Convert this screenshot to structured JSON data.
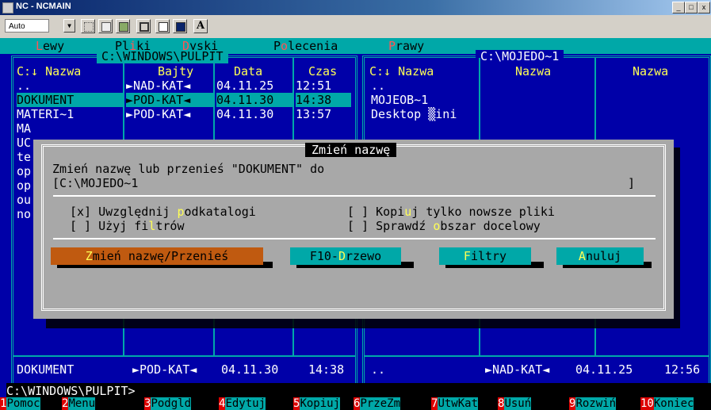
{
  "window": {
    "title": "NC - NCMAIN",
    "font_size_select": "Auto",
    "controls": [
      "_",
      "□",
      "x"
    ]
  },
  "menu": [
    {
      "label_pre": "",
      "hotkey": "L",
      "label_post": "ewy"
    },
    {
      "label_pre": "Pl",
      "hotkey": "i",
      "label_post": "ki"
    },
    {
      "label_pre": "",
      "hotkey": "D",
      "label_post": "yski"
    },
    {
      "label_pre": "P",
      "hotkey": "o",
      "label_post": "lecenia"
    },
    {
      "label_pre": "",
      "hotkey": "P",
      "label_post": "rawy"
    }
  ],
  "left_panel": {
    "path": "C:\\WINDOWS\\PULPIT",
    "headers": {
      "name": "C:↓ Nazwa",
      "bytes": "Bajty",
      "date": "Data",
      "time": "Czas"
    },
    "rows": [
      {
        "name": "..",
        "bytes": "►NAD-KAT◄",
        "date": "04.11.25",
        "time": "12:51"
      },
      {
        "name": "DOKUMENT",
        "bytes": "►POD-KAT◄",
        "date": "04.11.30",
        "time": "14:38"
      },
      {
        "name": "MATERI~1",
        "bytes": "►POD-KAT◄",
        "date": "04.11.30",
        "time": "13:57"
      },
      {
        "name": "MA",
        "bytes": "",
        "date": "",
        "time": ""
      },
      {
        "name": "UC",
        "bytes": "",
        "date": "",
        "time": ""
      },
      {
        "name": "te",
        "bytes": "",
        "date": "",
        "time": ""
      },
      {
        "name": "op",
        "bytes": "",
        "date": "",
        "time": ""
      },
      {
        "name": "op",
        "bytes": "",
        "date": "",
        "time": ""
      },
      {
        "name": "ou",
        "bytes": "",
        "date": "",
        "time": ""
      },
      {
        "name": "no",
        "bytes": "",
        "date": "",
        "time": ""
      }
    ],
    "selected_index": 1,
    "status": {
      "name": "DOKUMENT",
      "bytes": "►POD-KAT◄",
      "date": "04.11.30",
      "time": "14:38"
    }
  },
  "right_panel": {
    "path": "C:\\MOJEDO~1",
    "headers": [
      "C:↓ Nazwa",
      "Nazwa",
      "Nazwa"
    ],
    "rows": [
      "..",
      "MOJEOB~1",
      "Desktop ▒ini"
    ],
    "status": {
      "name": "..",
      "bytes": "►NAD-KAT◄",
      "date": "04.11.25",
      "time": "12:56"
    }
  },
  "dialog": {
    "title": "Zmień nazwę",
    "prompt": "Zmień nazwę lub przenieś \"DOKUMENT\" do",
    "target_value": "[C:\\MOJEDO~1",
    "target_end": "]",
    "options": [
      {
        "box": "[x]",
        "pre": "Uwzględnij ",
        "hotkey": "p",
        "post": "odkatalogi"
      },
      {
        "box": "[ ]",
        "pre": "Użyj fi",
        "hotkey": "l",
        "post": "trów"
      },
      {
        "box": "[ ]",
        "pre": "Kopi",
        "hotkey": "u",
        "post": "j tylko nowsze pliki"
      },
      {
        "box": "[ ]",
        "pre": "Sprawdź ",
        "hotkey": "o",
        "post": "bszar docelowy"
      }
    ],
    "buttons": [
      {
        "pre": "",
        "hotkey": "Z",
        "post": "mień nazwę/Przenieś",
        "color": "#c05a10"
      },
      {
        "pre": "F10-",
        "hotkey": "D",
        "post": "rzewo",
        "color": "#00a8a8"
      },
      {
        "pre": "",
        "hotkey": "F",
        "post": "iltry",
        "color": "#00a8a8"
      },
      {
        "pre": "",
        "hotkey": "A",
        "post": "nuluj",
        "color": "#00a8a8"
      }
    ]
  },
  "command_prompt": "C:\\WINDOWS\\PULPIT>",
  "function_keys": [
    {
      "num": "1",
      "label": "Pomoc"
    },
    {
      "num": "2",
      "label": "Menu"
    },
    {
      "num": "3",
      "label": "Podgld"
    },
    {
      "num": "4",
      "label": "Edytuj"
    },
    {
      "num": "5",
      "label": "Kopiuj"
    },
    {
      "num": "6",
      "label": "PrzeZm"
    },
    {
      "num": "7",
      "label": "UtwKat"
    },
    {
      "num": "8",
      "label": "Usuń"
    },
    {
      "num": "9",
      "label": "Rozwiń"
    },
    {
      "num": "10",
      "label": "Koniec"
    }
  ],
  "colors": {
    "dos_blue": "#0000a8",
    "dos_cyan": "#00a8a8",
    "dialog_gray": "#a8a8a8",
    "hotkey_yellow": "#ffff55",
    "hotkey_red": "#ff5555"
  }
}
